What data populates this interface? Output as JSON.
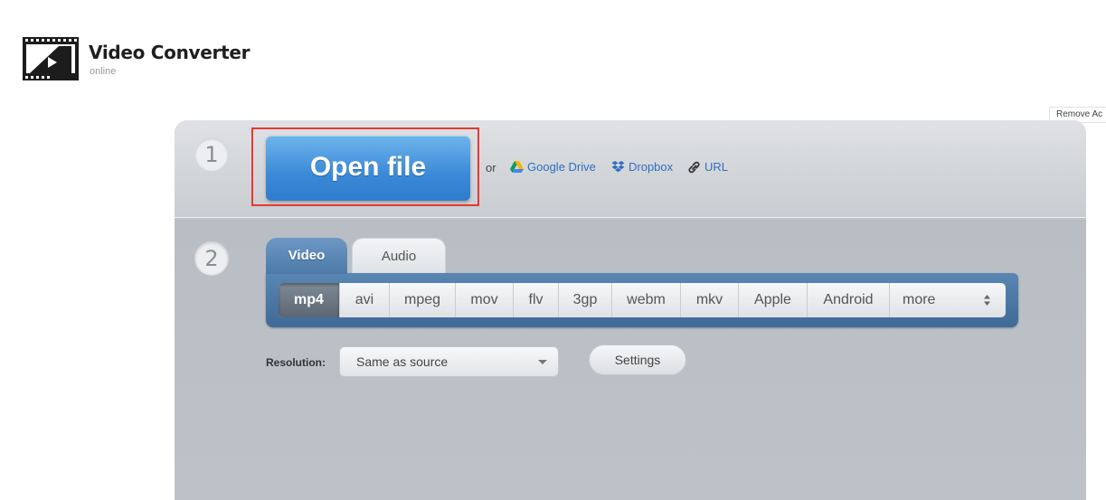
{
  "header": {
    "title": "Video Converter",
    "subtitle": "online",
    "remove_ads": "Remove Ac",
    "logo_icon": "film-clapper-icon"
  },
  "step1": {
    "number": "1",
    "open_file_label": "Open file",
    "or_label": "or",
    "sources": [
      {
        "label": "Google Drive",
        "icon": "google-drive-icon"
      },
      {
        "label": "Dropbox",
        "icon": "dropbox-icon"
      },
      {
        "label": "URL",
        "icon": "link-icon"
      }
    ]
  },
  "step2": {
    "number": "2",
    "tabs": [
      {
        "label": "Video",
        "active": true
      },
      {
        "label": "Audio",
        "active": false
      }
    ],
    "formats": [
      "mp4",
      "avi",
      "mpeg",
      "mov",
      "flv",
      "3gp",
      "webm",
      "mkv",
      "Apple",
      "Android",
      "more"
    ],
    "active_format": "mp4",
    "resolution_label": "Resolution:",
    "resolution_value": "Same as source",
    "settings_label": "Settings"
  },
  "colors": {
    "highlight_border": "#e53935",
    "open_button": "#3a8ad8",
    "link": "#2e6fc1",
    "tab_active": "#4c79a8"
  }
}
